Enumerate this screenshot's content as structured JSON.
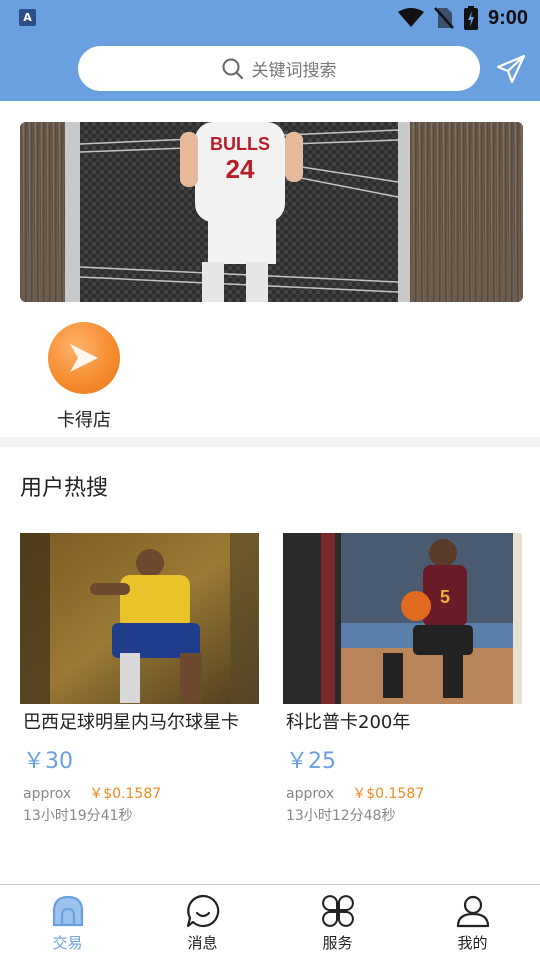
{
  "status_bar": {
    "time": "9:00",
    "app_icon_letter": "A"
  },
  "search": {
    "placeholder": "关键词搜索"
  },
  "shortcuts": [
    {
      "label": "卡得店",
      "icon": "play-icon"
    }
  ],
  "section": {
    "title": "用户热搜"
  },
  "products": [
    {
      "name": "巴西足球明星内马尔球星卡",
      "price": "￥30",
      "approx_label": "approx",
      "approx_usd": "￥$0.1587",
      "time_left": "13小时19分41秒"
    },
    {
      "name": "科比普卡200年",
      "price": "￥25",
      "approx_label": "approx",
      "approx_usd": "￥$0.1587",
      "time_left": "13小时12分48秒"
    }
  ],
  "tabs": [
    {
      "label": "交易",
      "icon": "trade-icon",
      "active": true
    },
    {
      "label": "消息",
      "icon": "message-icon",
      "active": false
    },
    {
      "label": "服务",
      "icon": "service-icon",
      "active": false
    },
    {
      "label": "我的",
      "icon": "profile-icon",
      "active": false
    }
  ],
  "colors": {
    "header": "#6aa0e0",
    "price": "#6aa0e0",
    "usd": "#ef8a1f",
    "shortcut": "#f58a2c"
  }
}
